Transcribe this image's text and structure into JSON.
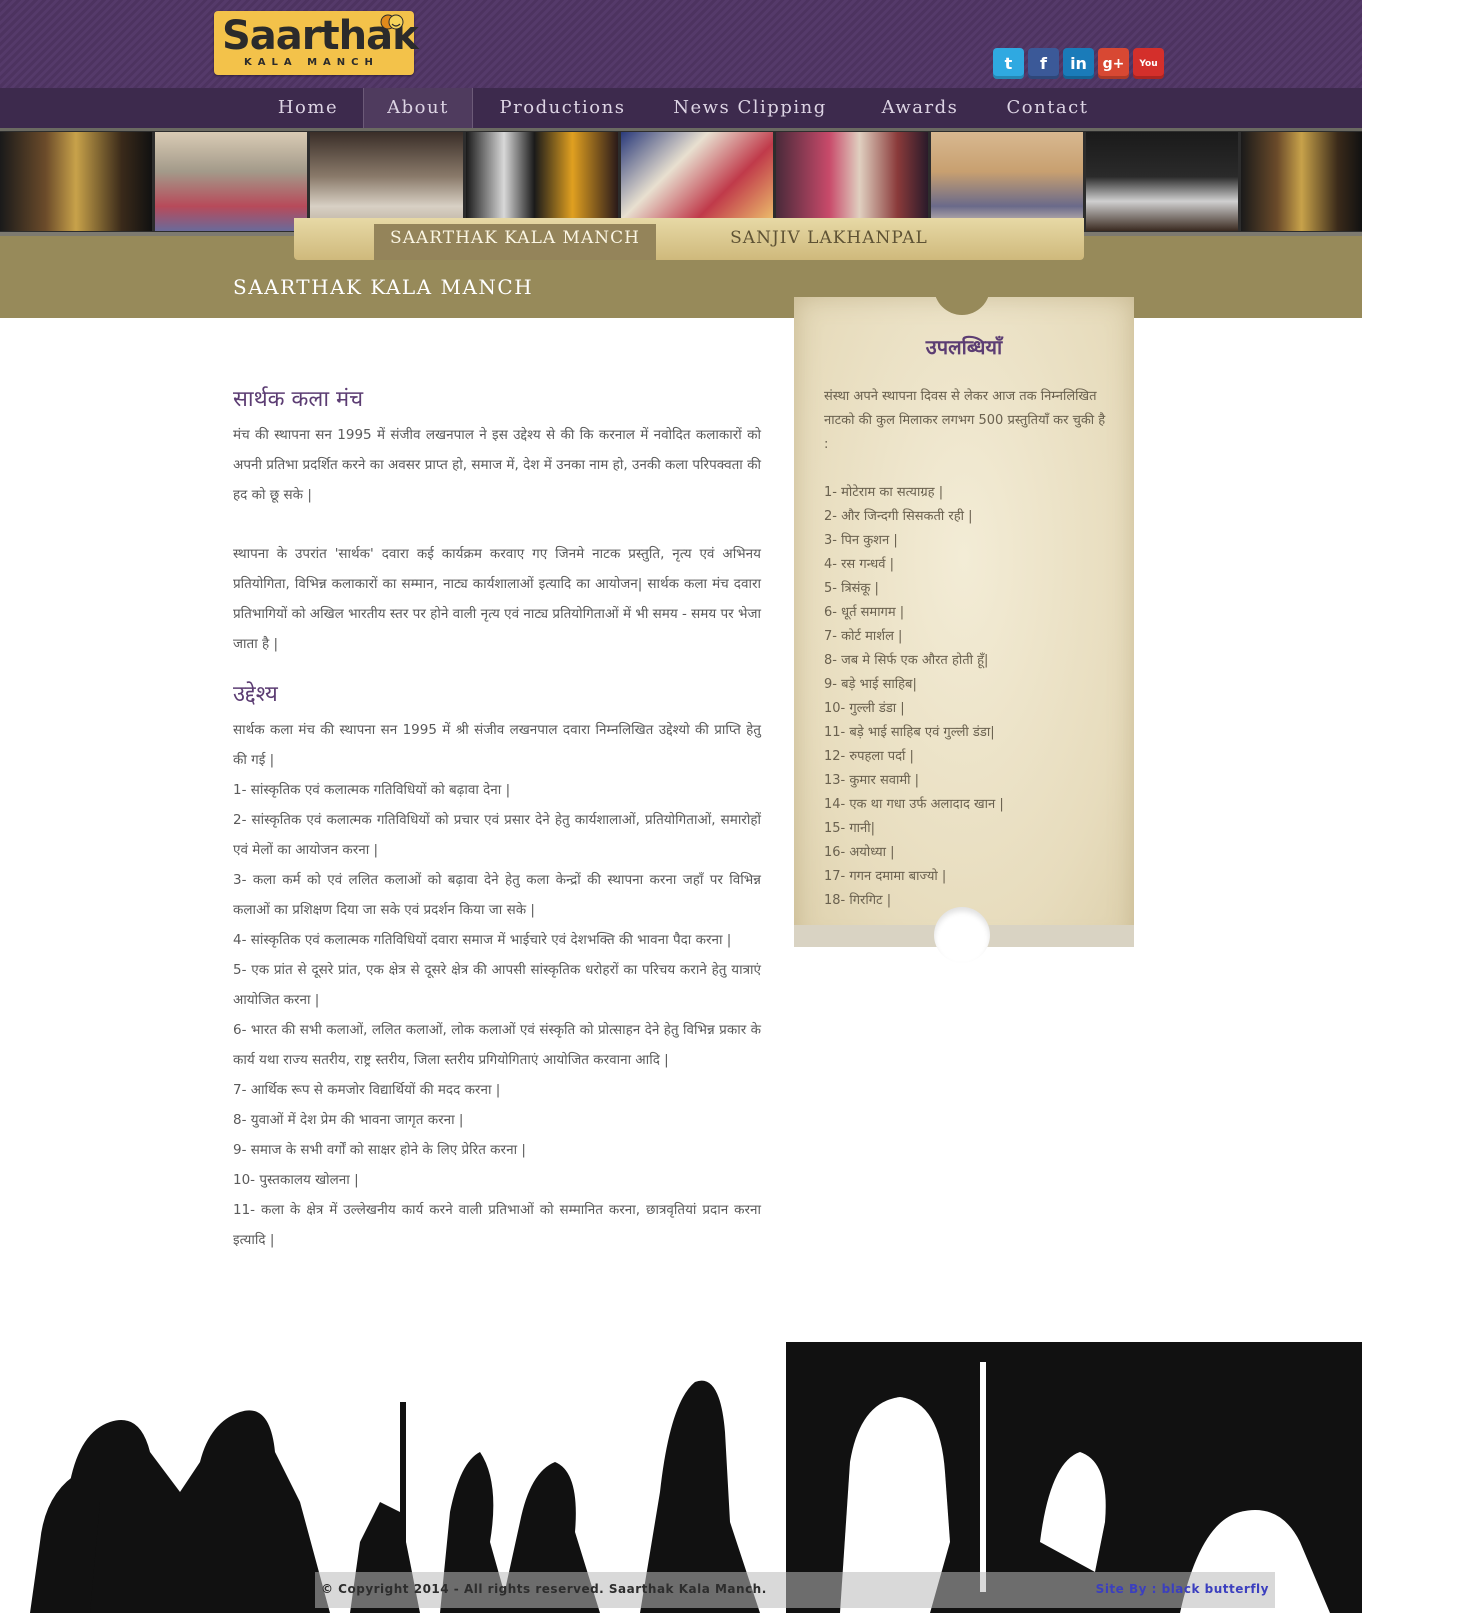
{
  "header": {
    "logo_text": "Saarthak",
    "logo_sub": "KALA MANCH",
    "social": [
      {
        "name": "twitter-icon",
        "glyph": "t",
        "cls": "tw"
      },
      {
        "name": "facebook-icon",
        "glyph": "f",
        "cls": "fb"
      },
      {
        "name": "linkedin-icon",
        "glyph": "in",
        "cls": "li"
      },
      {
        "name": "google-plus-icon",
        "glyph": "g+",
        "cls": "gp"
      },
      {
        "name": "youtube-icon",
        "glyph": "You",
        "cls": "yt"
      }
    ]
  },
  "nav": {
    "items": [
      "Home",
      "About",
      "Productions",
      "News Clipping",
      "Awards",
      "Contact"
    ],
    "active": "About"
  },
  "subnav": {
    "active": "SAARTHAK KALA MANCH",
    "other": "SANJIV LAKHANPAL"
  },
  "page_title": "SAARTHAK KALA MANCH",
  "main": {
    "heading1": "सार्थक कला मंच",
    "para1": "मंच की स्थापना सन 1995 में संजीव लखनपाल ने इस उद्देश्य से की कि करनाल में नवोदित कलाकारों को अपनी प्रतिभा प्रदर्शित करने का अवसर प्राप्त हो, समाज में, देश में उनका नाम हो, उनकी कला परिपक्वता की हद को छू सके |",
    "para2": "स्थापना के उपरांत 'सार्थक' दवारा कई कार्यक्रम करवाए गए जिनमे नाटक प्रस्तुति, नृत्य एवं अभिनय प्रतियोगिता, विभिन्न कलाकारों का सम्मान, नाट्य कार्यशालाओं इत्यादि का आयोजन| सार्थक कला मंच दवारा प्रतिभागियों को अखिल भारतीय स्तर पर होने वाली नृत्य एवं नाट्य प्रतियोगिताओं में भी समय - समय पर भेजा जाता है |",
    "heading2": "उद्देश्य",
    "para3": "सार्थक कला मंच की स्थापना सन 1995 में श्री संजीव लखनपाल दवारा निम्नलिखित उद्देश्यो की प्राप्ति हेतु की गई |",
    "objectives": [
      "1- सांस्कृतिक एवं कलात्मक गतिविधियों को बढ़ावा देना |",
      "2- सांस्कृतिक एवं कलात्मक गतिविधियों को प्रचार एवं प्रसार देने हेतु कार्यशालाओं, प्रतियोगिताओं, समारोहों एवं मेलों का आयोजन करना |",
      "3- कला कर्म को एवं ललित कलाओं को बढ़ावा देने हेतु कला केन्द्रों की स्थापना करना जहाँ पर विभिन्न कलाओं का प्रशिक्षण दिया जा सके एवं प्रदर्शन किया जा सके |",
      "4- सांस्कृतिक एवं कलात्मक गतिविधियों दवारा समाज में भाईचारे एवं देशभक्ति की भावना पैदा करना |",
      "5- एक प्रांत से दूसरे प्रांत, एक क्षेत्र से दूसरे क्षेत्र की आपसी सांस्कृतिक धरोहरों का परिचय कराने हेतु यात्राएं आयोजित करना |",
      "6- भारत की सभी कलाओं, ललित कलाओं, लोक कलाओं एवं संस्कृति को प्रोत्साहन देने हेतु विभिन्न प्रकार के कार्य यथा राज्य सतरीय, राष्ट्र स्तरीय, जिला स्तरीय प्रगियोगिताएं आयोजित करवाना आदि |",
      "7- आर्थिक रूप से कमजोर विद्यार्थियों की मदद करना |",
      "8- युवाओं में देश प्रेम की भावना जागृत करना |",
      "9- समाज के सभी वर्गों को साक्षर होने के लिए प्रेरित करना |",
      "10- पुस्तकालय खोलना |",
      "11- कला के क्षेत्र में उल्लेखनीय कार्य करने वाली प्रतिभाओं को सम्मानित करना, छात्रवृतियां प्रदान करना इत्यादि |"
    ]
  },
  "sidebar": {
    "title": "उपलब्धियाँ",
    "intro": "संस्था अपने स्थापना दिवस से लेकर आज तक निम्नलिखित नाटको की कुल मिलाकर लगभग 500 प्रस्तुतियाँ कर चुकी है :",
    "plays": [
      "1- मोटेराम का सत्याग्रह |",
      "2- और जिन्दगी सिसकती रही |",
      "3- पिन कुशन |",
      "4- रस गन्धर्व |",
      "5- त्रिसंकू |",
      "6- धूर्त समागम |",
      "7- कोर्ट मार्शल |",
      "8- जब मे सिर्फ एक औरत होती हूँ|",
      "9- बड़े भाई साहिब|",
      "10- गुल्ली डंडा |",
      "11- बड़े भाई साहिब एवं गुल्ली डंडा|",
      "12- रुपहला पर्दा |",
      "13- कुमार सवामी |",
      "14- एक था गधा उर्फ अलादाद खान |",
      "15- गानी|",
      "16- अयोध्या |",
      "17- गगन दमामा बाज्यो |",
      "18- गिरगिट |"
    ]
  },
  "footer": {
    "copyright": "© Copyright 2014 - All rights reserved. Saarthak Kala Manch.",
    "credit": "Site By : black butterfly"
  }
}
